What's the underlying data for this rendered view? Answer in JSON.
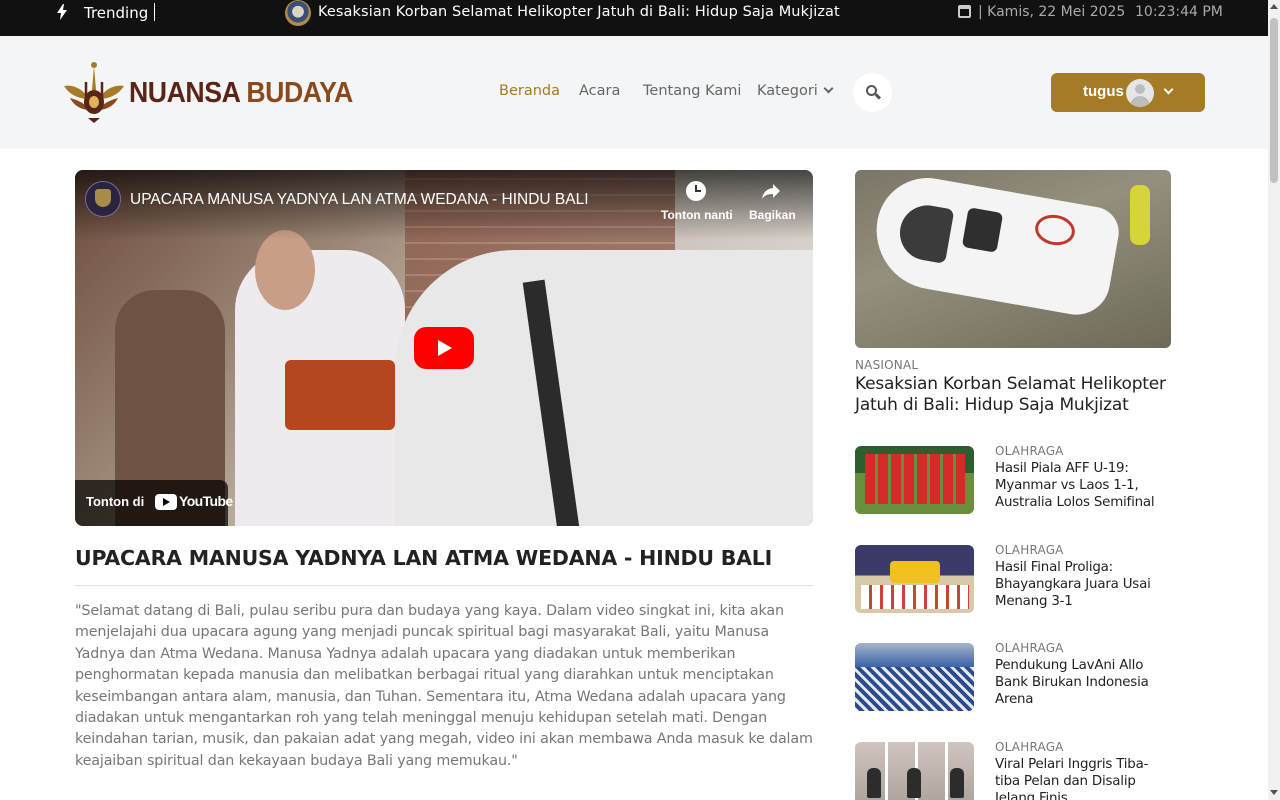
{
  "topbar": {
    "trending_label": "Trending",
    "headline": "Kesaksian Korban Selamat Helikopter Jatuh di Bali: Hidup Saja Mukjizat",
    "date": "| Kamis, 22 Mei 2025",
    "time": "10:23:44 PM",
    "icons": [
      "bolt-icon",
      "calendar-icon"
    ]
  },
  "header": {
    "brand_part1": "NUANSA ",
    "brand_part2": "BUDAYA",
    "nav": [
      {
        "label": "Beranda",
        "active": true
      },
      {
        "label": "Acara",
        "active": false
      },
      {
        "label": "Tentang Kami",
        "active": false
      },
      {
        "label": "Kategori",
        "active": false
      }
    ],
    "user_name": "tugus",
    "accent_color": "#a57b26"
  },
  "video": {
    "title": "UPACARA MANUSA YADNYA LAN ATMA WEDANA - HINDU BALI",
    "watch_later": "Tonton nanti",
    "share": "Bagikan",
    "watch_on": "Tonton di",
    "youtube": "YouTube"
  },
  "article": {
    "title": "UPACARA MANUSA YADNYA LAN ATMA WEDANA - HINDU BALI",
    "body": "\"Selamat datang di Bali, pulau seribu pura dan budaya yang kaya. Dalam video singkat ini, kita akan menjelajahi dua upacara agung yang menjadi puncak spiritual bagi masyarakat Bali, yaitu Manusa Yadnya dan Atma Wedana. Manusa Yadnya adalah upacara yang diadakan untuk memberikan penghormatan kepada manusia dan melibatkan berbagai ritual yang diarahkan untuk menciptakan keseimbangan antara alam, manusia, dan Tuhan. Sementara itu, Atma Wedana adalah upacara yang diadakan untuk mengantarkan roh yang telah meninggal menuju kehidupan setelah mati. Dengan keindahan tarian, musik, dan pakaian adat yang megah, video ini akan membawa Anda masuk ke dalam keajaiban spiritual dan kekayaan budaya Bali yang memukau.\""
  },
  "sidebar": {
    "featured": {
      "category": "NASIONAL",
      "title": "Kesaksian Korban Selamat Helikopter Jatuh di Bali: Hidup Saja Mukjizat"
    },
    "items": [
      {
        "category": "OLAHRAGA",
        "title": "Hasil Piala AFF U-19: Myanmar vs Laos 1-1, Australia Lolos Semifinal"
      },
      {
        "category": "OLAHRAGA",
        "title": "Hasil Final Proliga: Bhayangkara Juara Usai Menang 3-1"
      },
      {
        "category": "OLAHRAGA",
        "title": "Pendukung LavAni Allo Bank Birukan Indonesia Arena"
      },
      {
        "category": "OLAHRAGA",
        "title": "Viral Pelari Inggris Tiba-tiba Pelan dan Disalip Jelang Finis"
      }
    ]
  }
}
